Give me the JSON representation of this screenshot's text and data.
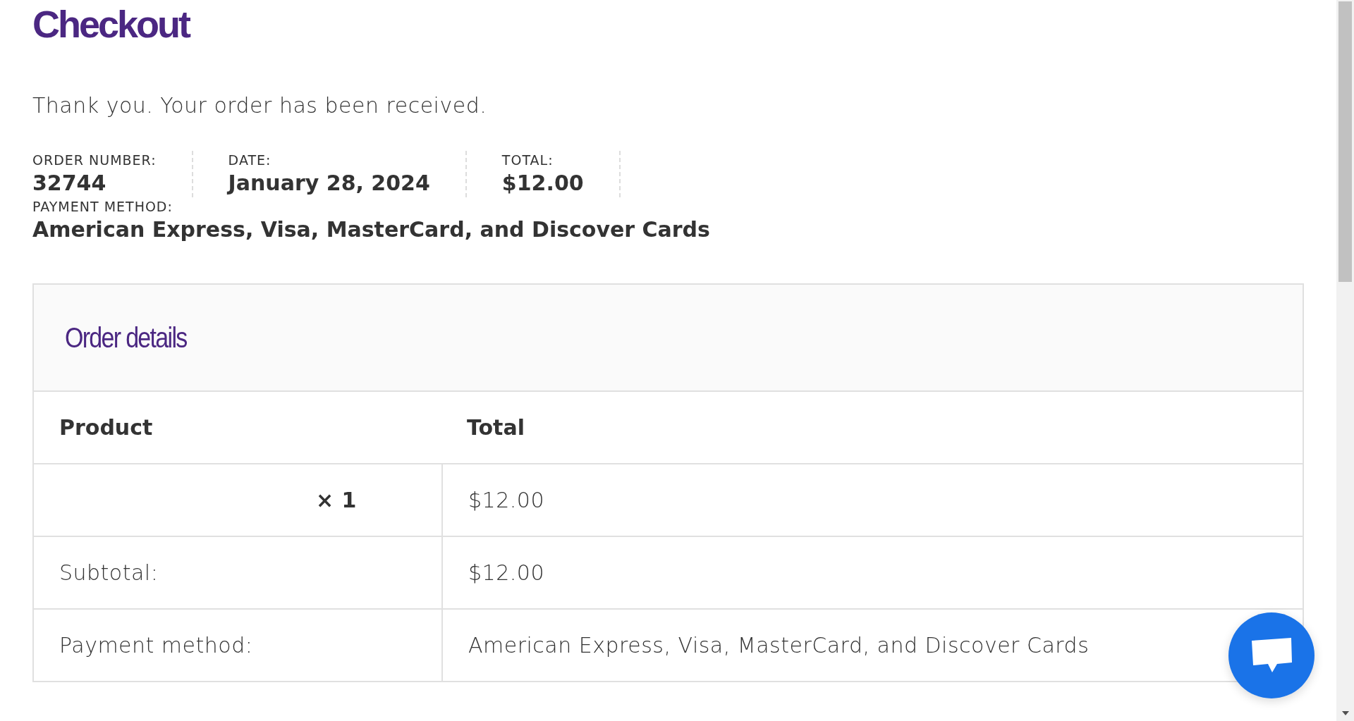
{
  "page_title": "Checkout",
  "notice": "Thank you. Your order has been received.",
  "overview": [
    {
      "label": "ORDER NUMBER:",
      "value": "32744",
      "divider": true
    },
    {
      "label": "DATE:",
      "value": "January 28, 2024",
      "divider": true
    },
    {
      "label": "TOTAL:",
      "value": "$12.00",
      "divider": true
    },
    {
      "label": "PAYMENT METHOD:",
      "value": "American Express, Visa, MasterCard, and Discover Cards",
      "divider": false
    }
  ],
  "order_details": {
    "title": "Order details",
    "columns": [
      "Product",
      "Total"
    ],
    "rows": [
      {
        "kind": "item",
        "quantity": "× 1",
        "total": "$12.00"
      },
      {
        "kind": "summary",
        "label": "Subtotal:",
        "total": "$12.00"
      },
      {
        "kind": "summary",
        "label": "Payment method:",
        "total": "American Express, Visa, MasterCard, and Discover Cards"
      }
    ]
  }
}
